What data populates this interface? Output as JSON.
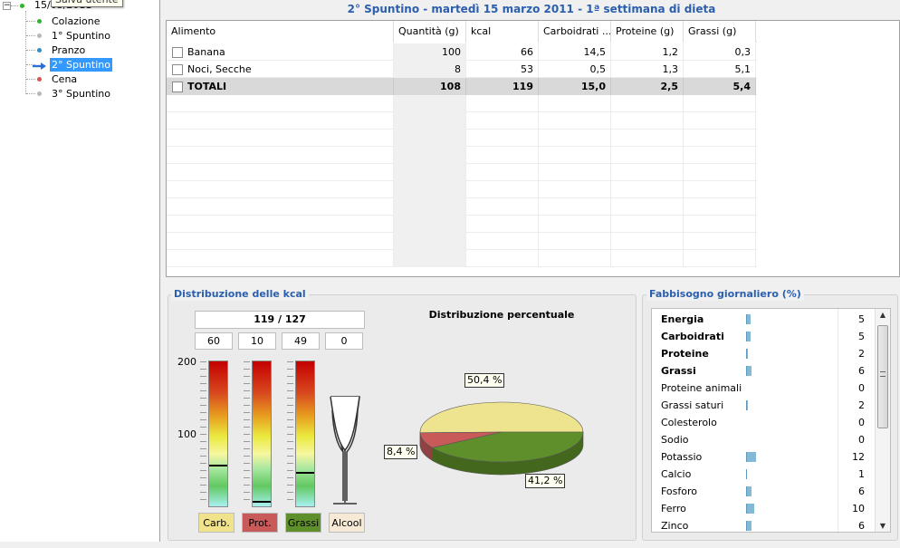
{
  "tree": {
    "date_label": "15/03/2011",
    "tooltip": "Salva utente",
    "items": [
      {
        "label": "Colazione",
        "color": "#2db52d"
      },
      {
        "label": "1° Spuntino",
        "color": "#b8b8b8"
      },
      {
        "label": "Pranzo",
        "color": "#2f8fc9"
      },
      {
        "label": "2° Spuntino",
        "color": "#b8b8b8",
        "selected": true
      },
      {
        "label": "Cena",
        "color": "#d9534f"
      },
      {
        "label": "3° Spuntino",
        "color": "#b8b8b8"
      }
    ],
    "root_color": "#2db52d",
    "selected_color": "#3399ff"
  },
  "meal_title": "2° Spuntino - martedì 15 marzo 2011 - 1ª settimana di dieta",
  "table": {
    "headers": [
      "Alimento",
      "Quantità (g)",
      "kcal",
      "Carboidrati ...",
      "Proteine (g)",
      "Grassi (g)"
    ],
    "rows": [
      [
        "Banana",
        "100",
        "66",
        "14,5",
        "1,2",
        "0,3"
      ],
      [
        "Noci, Secche",
        "8",
        "53",
        "0,5",
        "1,3",
        "5,1"
      ]
    ],
    "totals": [
      "TOTALI",
      "108",
      "119",
      "15,0",
      "2,5",
      "5,4"
    ]
  },
  "kcal_section": {
    "title": "Distribuzione delle kcal",
    "summary": "119 / 127",
    "sub_values": [
      "60",
      "10",
      "49",
      "0"
    ],
    "scale_labels": [
      "200",
      "100"
    ],
    "tube_levels": [
      0.29,
      0.04,
      0.24
    ],
    "tube_labels": [
      "Carb.",
      "Prot.",
      "Grassi",
      "Alcool"
    ],
    "tube_label_colors": [
      "#f0e38c",
      "#c85a5a",
      "#5f8f2a",
      "#f6ead7"
    ]
  },
  "pie": {
    "title": "Distribuzione percentuale",
    "labels": [
      "50,4 %",
      "8,4 %",
      "41,2 %"
    ],
    "values": [
      50.4,
      8.4,
      41.2
    ],
    "colors": [
      "#eee48f",
      "#c85a5a",
      "#5f8f2a"
    ]
  },
  "fab_section": {
    "title": "Fabbisogno giornaliero (%)",
    "items": [
      {
        "name": "Energia",
        "value": "5",
        "bold": true
      },
      {
        "name": "Carboidrati",
        "value": "5",
        "bold": true
      },
      {
        "name": "Proteine",
        "value": "2",
        "bold": true
      },
      {
        "name": "Grassi",
        "value": "6",
        "bold": true
      },
      {
        "name": "Proteine animali",
        "value": "0",
        "bold": false
      },
      {
        "name": "Grassi saturi",
        "value": "2",
        "bold": false
      },
      {
        "name": "Colesterolo",
        "value": "0",
        "bold": false
      },
      {
        "name": "Sodio",
        "value": "0",
        "bold": false
      },
      {
        "name": "Potassio",
        "value": "12",
        "bold": false
      },
      {
        "name": "Calcio",
        "value": "1",
        "bold": false
      },
      {
        "name": "Fosforo",
        "value": "6",
        "bold": false
      },
      {
        "name": "Ferro",
        "value": "10",
        "bold": false
      },
      {
        "name": "Zinco",
        "value": "6",
        "bold": false
      }
    ]
  }
}
